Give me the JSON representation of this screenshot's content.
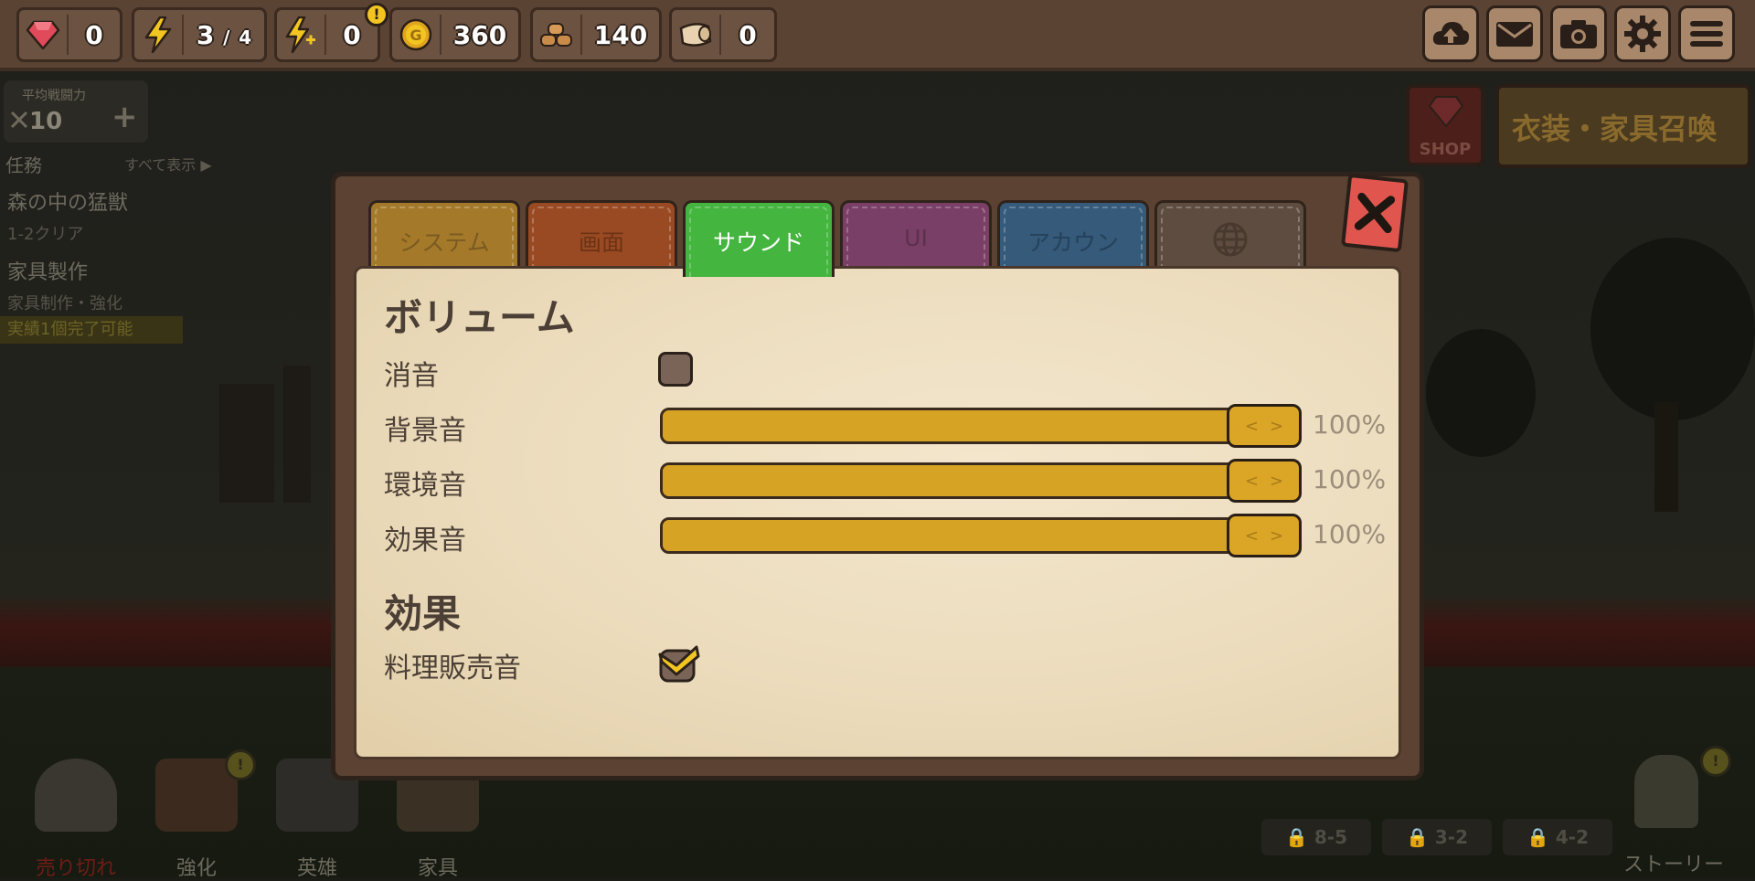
{
  "topbar": {
    "gems": "0",
    "stamina_current": "3",
    "stamina_max": "4",
    "stamina_separator": "/",
    "bonus_stamina": "0",
    "gold": "360",
    "wood": "140",
    "cloth": "0",
    "buttons": [
      "cloud-upload-icon",
      "mail-icon",
      "camera-icon",
      "settings-gear-icon",
      "menu-icon"
    ]
  },
  "left_panel": {
    "power_label": "平均戦闘力",
    "power_value": "10",
    "power_plus": "+",
    "quest_header": "任務",
    "quest_show_all": "すべて表示 ▶",
    "quests": [
      {
        "title": "森の中の猛獣",
        "subtitle": "1-2クリア"
      },
      {
        "title": "家具製作",
        "subtitle": "家具制作・強化"
      }
    ],
    "achievement": "実績1個完了可能"
  },
  "right_banners": {
    "shop_label": "SHOP",
    "summon_label": "衣装・家具召喚"
  },
  "bottom_bar": {
    "items": [
      {
        "label": "売り切れ"
      },
      {
        "label": "強化"
      },
      {
        "label": "英雄"
      },
      {
        "label": "家具"
      }
    ],
    "stages": [
      "8-5",
      "3-2",
      "4-2"
    ],
    "story_label": "ストーリー"
  },
  "settings": {
    "tabs": [
      {
        "label": "システム",
        "color": "#a47a2a",
        "text_color": "#7a5a22"
      },
      {
        "label": "画面",
        "color": "#9a4a22",
        "text_color": "#6c3316"
      },
      {
        "label": "サウンド",
        "color": "#44b53f",
        "text_color": "#ffffff"
      },
      {
        "label": "UI",
        "color": "#7a3f66",
        "text_color": "#5d2f4d"
      },
      {
        "label": "アカウン",
        "color": "#355a7a",
        "text_color": "#26415a"
      },
      {
        "label": "",
        "color": "#5e4c40",
        "text_color": "#48392f"
      }
    ],
    "active_tab": "サウンド",
    "volume_heading": "ボリューム",
    "mute_label": "消音",
    "mute_checked": false,
    "sliders": [
      {
        "label": "背景音",
        "value": 100,
        "value_text": "100%"
      },
      {
        "label": "環境音",
        "value": 100,
        "value_text": "100%"
      },
      {
        "label": "効果音",
        "value": 100,
        "value_text": "100%"
      }
    ],
    "handle_arrows": [
      "<",
      ">"
    ],
    "effects_heading": "効果",
    "cooking_sale_sound_label": "料理販売音",
    "cooking_sale_sound_checked": true
  }
}
